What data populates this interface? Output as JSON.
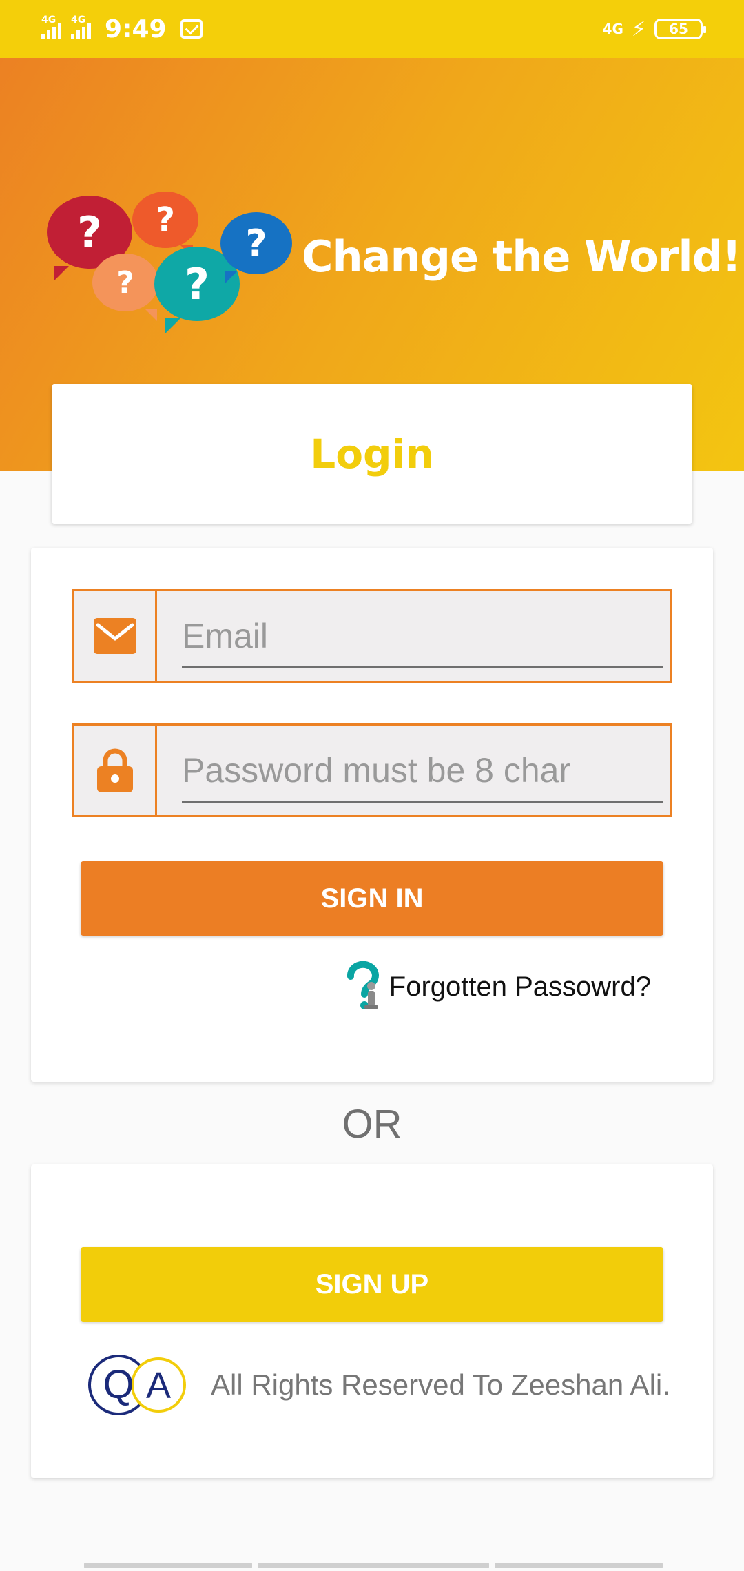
{
  "status_bar": {
    "network_1": "4G",
    "network_2": "4G",
    "time": "9:49",
    "network_right": "4G",
    "battery": "65"
  },
  "header": {
    "headline": "Change the World!",
    "bubble_glyph": "?"
  },
  "login_card": {
    "title": "Login"
  },
  "form": {
    "email_placeholder": "Email",
    "password_placeholder": "Password must be 8 char",
    "signin_label": "SIGN IN",
    "forgot_label": "Forgotten Passowrd?"
  },
  "separator": {
    "or_label": "OR"
  },
  "signup": {
    "signup_label": "SIGN UP",
    "copyright": "All Rights Reserved To Zeeshan Ali.",
    "logo_text": "QA"
  },
  "colors": {
    "accent_orange": "#ec8123",
    "accent_yellow": "#f2cd0a"
  },
  "icons": {
    "email": "envelope-icon",
    "password": "lock-icon",
    "forgot": "question-person-icon"
  }
}
